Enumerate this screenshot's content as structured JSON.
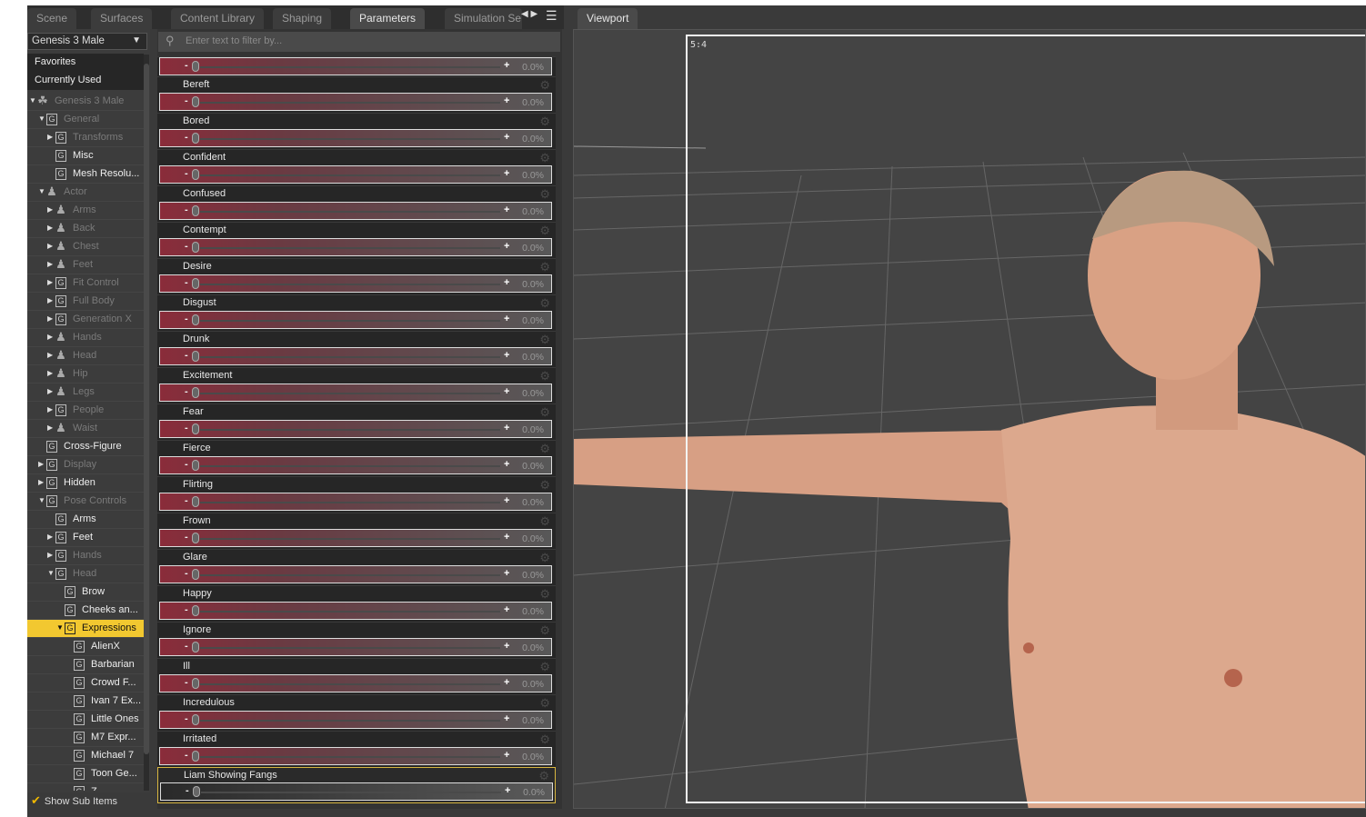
{
  "tabs": [
    {
      "label": "Scene"
    },
    {
      "label": "Surfaces"
    },
    {
      "label": "Content Library"
    },
    {
      "label": "Shaping"
    },
    {
      "label": "Parameters",
      "active": true
    },
    {
      "label": "Simulation Se"
    }
  ],
  "tab_arrows": "◀ ▶",
  "figure_select": "Genesis 3 Male",
  "fixed_items": [
    "Favorites",
    "Currently Used"
  ],
  "tree": [
    {
      "label": "Genesis 3 Male",
      "level": 0,
      "exp": "open",
      "icon": "group",
      "dim": true
    },
    {
      "label": "General",
      "level": 1,
      "exp": "open",
      "icon": "G",
      "dim": true
    },
    {
      "label": "Transforms",
      "level": 2,
      "exp": "closed",
      "icon": "G",
      "dim": true
    },
    {
      "label": "Misc",
      "level": 2,
      "exp": "",
      "icon": "G"
    },
    {
      "label": "Mesh Resolu...",
      "level": 2,
      "exp": "",
      "icon": "G"
    },
    {
      "label": "Actor",
      "level": 1,
      "exp": "open",
      "icon": "fig",
      "dim": true
    },
    {
      "label": "Arms",
      "level": 2,
      "exp": "closed",
      "icon": "fig",
      "dim": true
    },
    {
      "label": "Back",
      "level": 2,
      "exp": "closed",
      "icon": "fig",
      "dim": true
    },
    {
      "label": "Chest",
      "level": 2,
      "exp": "closed",
      "icon": "fig",
      "dim": true
    },
    {
      "label": "Feet",
      "level": 2,
      "exp": "closed",
      "icon": "fig",
      "dim": true
    },
    {
      "label": "Fit Control",
      "level": 2,
      "exp": "closed",
      "icon": "G",
      "dim": true
    },
    {
      "label": "Full Body",
      "level": 2,
      "exp": "closed",
      "icon": "G",
      "dim": true
    },
    {
      "label": "Generation X",
      "level": 2,
      "exp": "closed",
      "icon": "G",
      "dim": true
    },
    {
      "label": "Hands",
      "level": 2,
      "exp": "closed",
      "icon": "fig",
      "dim": true
    },
    {
      "label": "Head",
      "level": 2,
      "exp": "closed",
      "icon": "fig",
      "dim": true
    },
    {
      "label": "Hip",
      "level": 2,
      "exp": "closed",
      "icon": "fig",
      "dim": true
    },
    {
      "label": "Legs",
      "level": 2,
      "exp": "closed",
      "icon": "fig",
      "dim": true
    },
    {
      "label": "People",
      "level": 2,
      "exp": "closed",
      "icon": "G",
      "dim": true
    },
    {
      "label": "Waist",
      "level": 2,
      "exp": "closed",
      "icon": "fig",
      "dim": true
    },
    {
      "label": "Cross-Figure",
      "level": 1,
      "exp": "",
      "icon": "G"
    },
    {
      "label": "Display",
      "level": 1,
      "exp": "closed",
      "icon": "G",
      "dim": true
    },
    {
      "label": "Hidden",
      "level": 1,
      "exp": "closed",
      "icon": "G"
    },
    {
      "label": "Pose Controls",
      "level": 1,
      "exp": "open",
      "icon": "G",
      "dim": true
    },
    {
      "label": "Arms",
      "level": 2,
      "exp": "",
      "icon": "G"
    },
    {
      "label": "Feet",
      "level": 2,
      "exp": "closed",
      "icon": "G"
    },
    {
      "label": "Hands",
      "level": 2,
      "exp": "closed",
      "icon": "G",
      "dim": true
    },
    {
      "label": "Head",
      "level": 2,
      "exp": "open",
      "icon": "G",
      "dim": true
    },
    {
      "label": "Brow",
      "level": 3,
      "exp": "",
      "icon": "G"
    },
    {
      "label": "Cheeks an...",
      "level": 3,
      "exp": "",
      "icon": "G"
    },
    {
      "label": "Expressions",
      "level": 3,
      "exp": "open",
      "icon": "G",
      "selected": true
    },
    {
      "label": "AlienX",
      "level": 4,
      "exp": "",
      "icon": "G"
    },
    {
      "label": "Barbarian",
      "level": 4,
      "exp": "",
      "icon": "G"
    },
    {
      "label": "Crowd F...",
      "level": 4,
      "exp": "",
      "icon": "G"
    },
    {
      "label": "Ivan 7 Ex...",
      "level": 4,
      "exp": "",
      "icon": "G"
    },
    {
      "label": "Little Ones",
      "level": 4,
      "exp": "",
      "icon": "G"
    },
    {
      "label": "M7 Expr...",
      "level": 4,
      "exp": "",
      "icon": "G"
    },
    {
      "label": "Michael 7",
      "level": 4,
      "exp": "",
      "icon": "G"
    },
    {
      "label": "Toon Ge...",
      "level": 4,
      "exp": "",
      "icon": "G"
    },
    {
      "label": "Z...",
      "level": 4,
      "exp": "",
      "icon": "G"
    }
  ],
  "show_sub_items": {
    "label": "Show Sub Items",
    "checked": true
  },
  "filter_placeholder": "Enter text to filter by...",
  "parameters": [
    {
      "label": "",
      "value": "0.0%"
    },
    {
      "label": "Bereft",
      "value": "0.0%"
    },
    {
      "label": "Bored",
      "value": "0.0%"
    },
    {
      "label": "Confident",
      "value": "0.0%"
    },
    {
      "label": "Confused",
      "value": "0.0%"
    },
    {
      "label": "Contempt",
      "value": "0.0%"
    },
    {
      "label": "Desire",
      "value": "0.0%"
    },
    {
      "label": "Disgust",
      "value": "0.0%"
    },
    {
      "label": "Drunk",
      "value": "0.0%"
    },
    {
      "label": "Excitement",
      "value": "0.0%"
    },
    {
      "label": "Fear",
      "value": "0.0%"
    },
    {
      "label": "Fierce",
      "value": "0.0%"
    },
    {
      "label": "Flirting",
      "value": "0.0%"
    },
    {
      "label": "Frown",
      "value": "0.0%"
    },
    {
      "label": "Glare",
      "value": "0.0%"
    },
    {
      "label": "Happy",
      "value": "0.0%"
    },
    {
      "label": "Ignore",
      "value": "0.0%"
    },
    {
      "label": "Ill",
      "value": "0.0%"
    },
    {
      "label": "Incredulous",
      "value": "0.0%"
    },
    {
      "label": "Irritated",
      "value": "0.0%"
    },
    {
      "label": "Liam Showing Fangs",
      "value": "0.0%",
      "selected": true
    }
  ],
  "viewport": {
    "tab": "Viewport",
    "aspect": "5:4"
  }
}
